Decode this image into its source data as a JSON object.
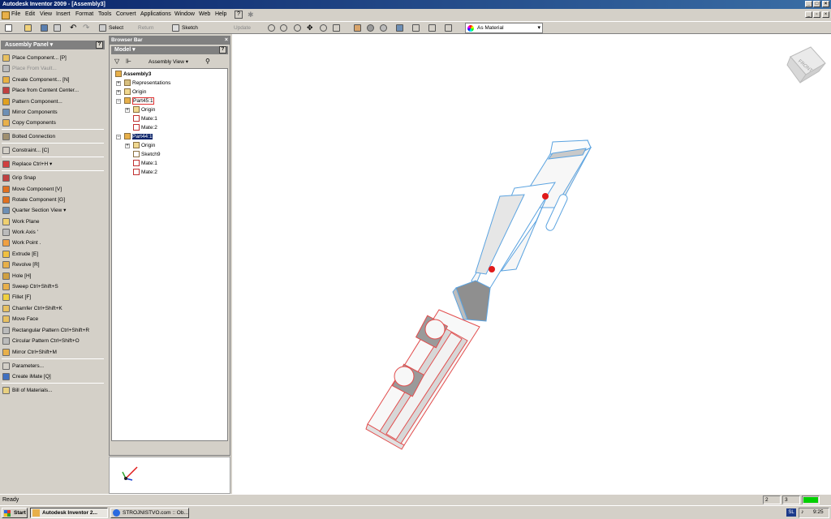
{
  "window": {
    "title": "Autodesk Inventor 2009 - [Assembly3]"
  },
  "menubar": {
    "items": [
      "File",
      "Edit",
      "View",
      "Insert",
      "Format",
      "Tools",
      "Convert",
      "Applications",
      "Window",
      "Web",
      "Help"
    ]
  },
  "toolbar": {
    "select": "Select",
    "return": "Return",
    "sketch": "Sketch",
    "update": "Update",
    "material": "As Material"
  },
  "assembly_panel": {
    "title": "Assembly Panel",
    "tools": [
      {
        "label": "Place Component...   [P]",
        "icon": "place-component-icon"
      },
      {
        "label": "Place From Vault...",
        "icon": "vault-icon",
        "disabled": true
      },
      {
        "label": "Create Component...   [N]",
        "icon": "create-component-icon"
      },
      {
        "label": "Place from Content Center...",
        "icon": "content-center-icon"
      },
      {
        "label": "Pattern Component...",
        "icon": "pattern-icon"
      },
      {
        "label": "Mirror Components",
        "icon": "mirror-icon"
      },
      {
        "label": "Copy Components",
        "icon": "copy-icon"
      },
      {
        "label": "Bolted Connection",
        "icon": "bolt-icon"
      },
      {
        "label": "Constraint...   [C]",
        "icon": "constraint-icon"
      },
      {
        "label": "Replace   Ctrl+H  ▾",
        "icon": "replace-icon"
      },
      {
        "label": "Grip Snap",
        "icon": "grip-snap-icon"
      },
      {
        "label": "Move Component   [V]",
        "icon": "move-icon"
      },
      {
        "label": "Rotate Component   [G]",
        "icon": "rotate-icon"
      },
      {
        "label": "Quarter Section View  ▾",
        "icon": "section-icon"
      },
      {
        "label": "Work Plane",
        "icon": "work-plane-icon"
      },
      {
        "label": "Work Axis   '",
        "icon": "work-axis-icon"
      },
      {
        "label": "Work Point   .",
        "icon": "work-point-icon"
      },
      {
        "label": "Extrude   [E]",
        "icon": "extrude-icon"
      },
      {
        "label": "Revolve   [R]",
        "icon": "revolve-icon"
      },
      {
        "label": "Hole   [H]",
        "icon": "hole-icon"
      },
      {
        "label": "Sweep   Ctrl+Shift+S",
        "icon": "sweep-icon"
      },
      {
        "label": "Fillet   [F]",
        "icon": "fillet-icon"
      },
      {
        "label": "Chamfer   Ctrl+Shift+K",
        "icon": "chamfer-icon"
      },
      {
        "label": "Move Face",
        "icon": "move-face-icon"
      },
      {
        "label": "Rectangular Pattern   Ctrl+Shift+R",
        "icon": "rect-pattern-icon"
      },
      {
        "label": "Circular Pattern   Ctrl+Shift+O",
        "icon": "circ-pattern-icon"
      },
      {
        "label": "Mirror   Ctrl+Shift+M",
        "icon": "mirror-feature-icon"
      },
      {
        "label": "Parameters...",
        "icon": "parameters-icon"
      },
      {
        "label": "Create iMate   [Q]",
        "icon": "imate-icon"
      },
      {
        "label": "Bill of Materials...",
        "icon": "bom-icon"
      }
    ]
  },
  "browser": {
    "title": "Browser Bar",
    "model": "Model",
    "view": "Assembly View",
    "tree": [
      {
        "label": "Assembly3",
        "level": 0
      },
      {
        "label": "Representations",
        "level": 1
      },
      {
        "label": "Origin",
        "level": 1
      },
      {
        "label": "Part45:1",
        "level": 1
      },
      {
        "label": "Origin",
        "level": 2
      },
      {
        "label": "Mate:1",
        "level": 2
      },
      {
        "label": "Mate:2",
        "level": 2
      },
      {
        "label": "Part44:1",
        "level": 1
      },
      {
        "label": "Origin",
        "level": 2
      },
      {
        "label": "Sketch9",
        "level": 2
      },
      {
        "label": "Mate:1",
        "level": 2
      },
      {
        "label": "Mate:2",
        "level": 2
      }
    ]
  },
  "viewcube": {
    "face": "FRONT"
  },
  "status": {
    "text": "Ready",
    "num1": "2",
    "num2": "3"
  },
  "taskbar": {
    "start": "Start",
    "task1": "Autodesk Inventor 2...",
    "task2": "STROJNISTVO.com :: Ob...",
    "lang": "SL",
    "time": "9:25"
  }
}
